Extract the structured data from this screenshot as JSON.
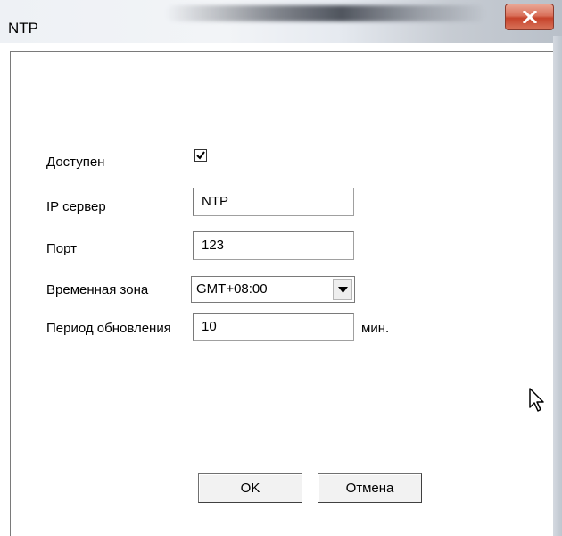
{
  "window": {
    "title": "NTP"
  },
  "form": {
    "enabled": {
      "label": "Доступен",
      "checked": true
    },
    "ip_server": {
      "label": "IP сервер",
      "value": "NTP"
    },
    "port": {
      "label": "Порт",
      "value": "123"
    },
    "timezone": {
      "label": "Временная зона",
      "selected": "GMT+08:00"
    },
    "update_period": {
      "label": "Период обновления",
      "value": "10",
      "unit": "мин."
    }
  },
  "buttons": {
    "ok_label": "OK",
    "cancel_label": "Отмена"
  },
  "icons": {
    "close": "close-icon",
    "checkmark": "checkmark-icon",
    "dropdown": "chevron-down-icon",
    "cursor": "mouse-cursor-icon"
  },
  "colors": {
    "close_button": "#c6432b",
    "window_background": "#ffffff"
  }
}
